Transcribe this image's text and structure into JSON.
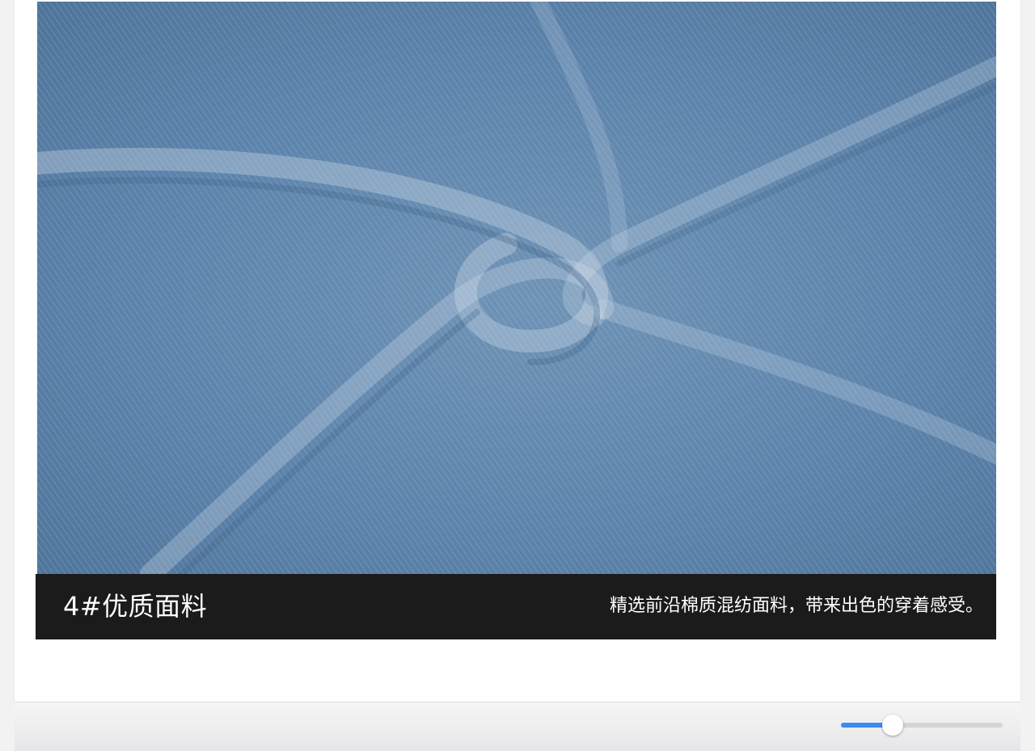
{
  "product_detail": {
    "image": {
      "subject": "denim-fabric-swirl"
    },
    "caption": {
      "title": "4#优质面料",
      "description": "精选前沿棉质混纺面料，带来出色的穿着感受。"
    }
  },
  "viewer": {
    "zoom_slider": {
      "value_fraction": 0.32
    }
  },
  "colors": {
    "denim": "#5f86ad",
    "caption_background": "#1b1b1b",
    "slider_accent": "#3d8bf0"
  }
}
